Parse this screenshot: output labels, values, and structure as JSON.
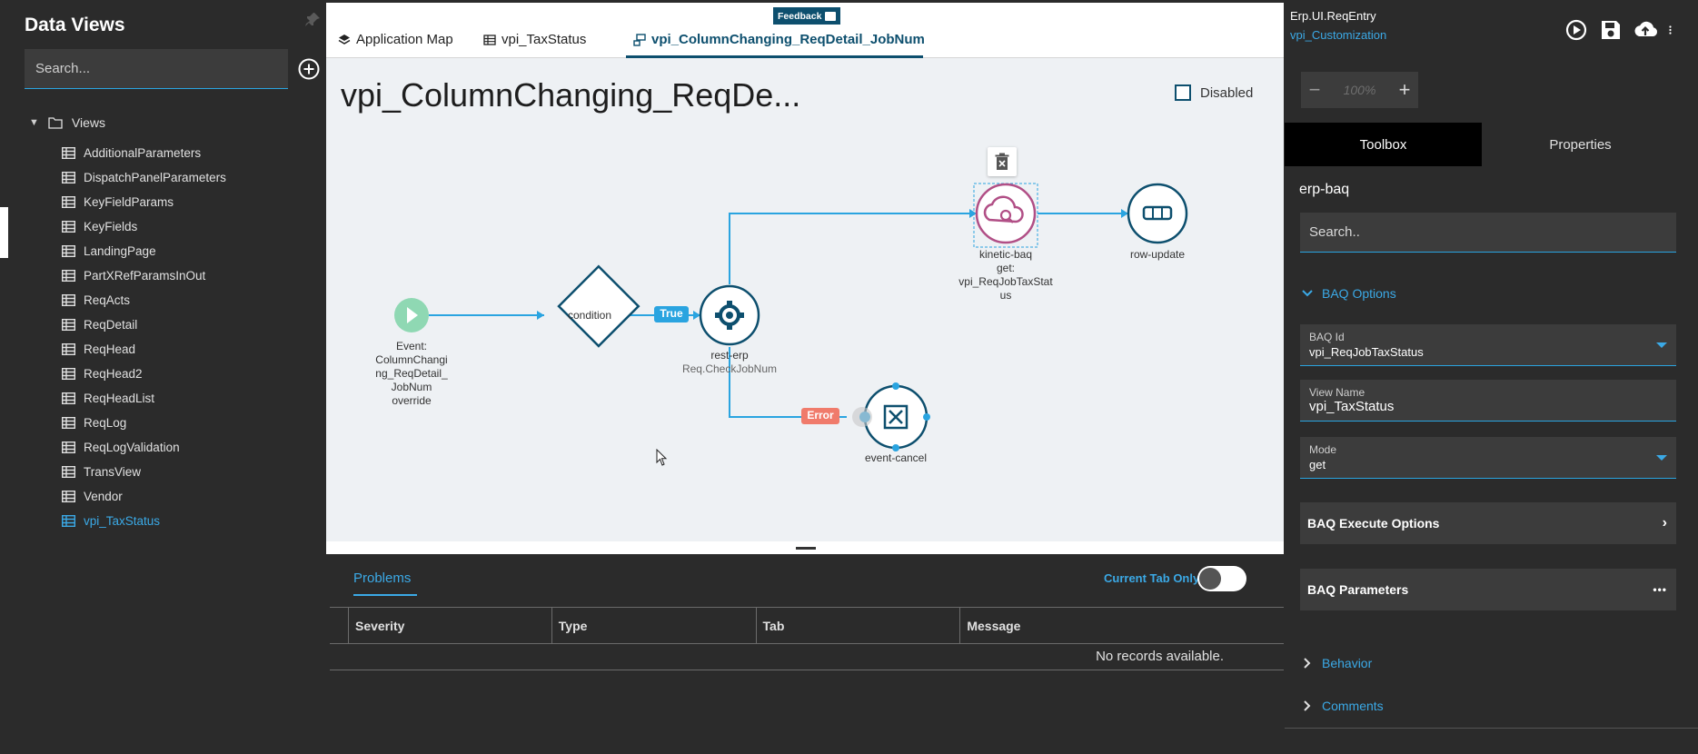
{
  "left_panel": {
    "title": "Data Views",
    "search_placeholder": "Search...",
    "root_label": "Views",
    "items": [
      {
        "label": "AdditionalParameters"
      },
      {
        "label": "DispatchPanelParameters"
      },
      {
        "label": "KeyFieldParams"
      },
      {
        "label": "KeyFields"
      },
      {
        "label": "LandingPage"
      },
      {
        "label": "PartXRefParamsInOut"
      },
      {
        "label": "ReqActs"
      },
      {
        "label": "ReqDetail"
      },
      {
        "label": "ReqHead"
      },
      {
        "label": "ReqHead2"
      },
      {
        "label": "ReqHeadList"
      },
      {
        "label": "ReqLog"
      },
      {
        "label": "ReqLogValidation"
      },
      {
        "label": "TransView"
      },
      {
        "label": "Vendor"
      },
      {
        "label": "vpi_TaxStatus"
      }
    ],
    "active_item": "vpi_TaxStatus"
  },
  "feedback_label": "Feedback",
  "tabs": [
    {
      "label": "Application Map"
    },
    {
      "label": "vpi_TaxStatus"
    },
    {
      "label": "vpi_ColumnChanging_ReqDetail_JobNum"
    }
  ],
  "canvas": {
    "title": "vpi_ColumnChanging_ReqDe...",
    "disabled_label": "Disabled",
    "nodes": {
      "event": {
        "l1": "Event:",
        "l2": "ColumnChangi",
        "l3": "ng_ReqDetail_",
        "l4": "JobNum",
        "l5": "override"
      },
      "condition": {
        "label": "condition"
      },
      "true_label": "True",
      "rest_erp": {
        "label": "rest-erp",
        "sub": "Req.CheckJobNum"
      },
      "kinetic_baq": {
        "l1": "kinetic-baq",
        "l2": "get:",
        "l3": "vpi_ReqJobTaxStat",
        "l4": "us"
      },
      "row_update": {
        "label": "row-update"
      },
      "error_label": "Error",
      "event_cancel": {
        "label": "event-cancel"
      }
    }
  },
  "problems": {
    "tab_label": "Problems",
    "current_tab_only": "Current Tab Only",
    "columns": [
      "Severity",
      "Type",
      "Tab",
      "Message"
    ],
    "empty_message": "No records available."
  },
  "right_panel": {
    "app_name": "Erp.UI.ReqEntry",
    "customization": "vpi_Customization",
    "zoom": {
      "minus": "−",
      "value": "100%",
      "plus": "+"
    },
    "tabs": [
      "Toolbox",
      "Properties"
    ],
    "tool_name": "erp-baq",
    "search_placeholder": "Search..",
    "baq_options_label": "BAQ Options",
    "fields": {
      "baq_id": {
        "label": "BAQ Id",
        "value": "vpi_ReqJobTaxStatus"
      },
      "view_name": {
        "label": "View Name",
        "value": "vpi_TaxStatus"
      },
      "mode": {
        "label": "Mode",
        "value": "get"
      }
    },
    "baq_execute_options": "BAQ Execute Options",
    "baq_parameters": "BAQ Parameters",
    "behavior_label": "Behavior",
    "comments_label": "Comments"
  },
  "colors": {
    "accent": "#3ba9e6",
    "node_teal": "#0d4f6e",
    "baq_pink": "#b14f86",
    "true_badge": "#2aa4e0",
    "error_badge": "#f07b6b",
    "start_green": "#8fd8b3"
  }
}
